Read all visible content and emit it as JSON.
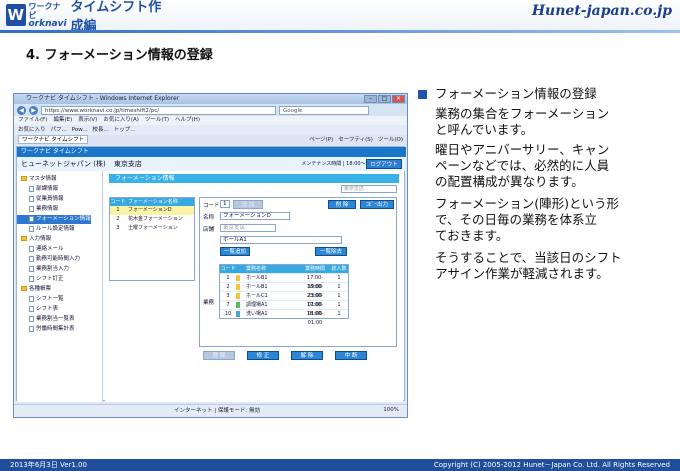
{
  "header": {
    "logo_top": "ワークナビ",
    "logo_bottom": "orknavi",
    "logo_letter": "W",
    "product_title": "タイムシフト作成編",
    "brand": "Hunet-japan.co.jp"
  },
  "slide_title": "4. フォーメーション情報の登録",
  "body_lines": [
    "フォーメーション情報の登録",
    "業務の集合をフォーメーション",
    "と呼んでいます。",
    "曜日やアニバーサリー、キャン",
    "ペーンなどでは、必然的に人員",
    "の配置構成が異なります。",
    "フォーメーション(陣形)という形",
    "で、その日毎の業務を体系立",
    "ておきます。",
    "そうすることで、当該日のシフト",
    "アサイン作業が軽減されます。"
  ],
  "footer": {
    "date": "2013年6月3日 Ver1.00",
    "copyright": "Copyright (C) 2005-2012 Hunet－Japan Co. Ltd. All Rights Reserved"
  },
  "browser": {
    "title": "ワークナビ タイムシフト - Windows Internet Explorer",
    "address": "https://www.worknavi.co.jp/timeshift2/pc/",
    "search": "Google",
    "menus": [
      "ファイル(F)",
      "編集(E)",
      "表示(V)",
      "お気に入り(A)",
      "ツール(T)",
      "ヘルプ(H)"
    ],
    "fav_items": [
      "お気に入り",
      "パフ...",
      "Pow...",
      "校長...",
      "トップ..."
    ],
    "tab_label": "ワークナビ タイムシフト",
    "tools": [
      "ページ(P)",
      "セーフティ(S)",
      "ツール(O)"
    ],
    "status_text": "インターネット | 保護モード: 無効",
    "zoom": "100%"
  },
  "app": {
    "bar_title": "ワークナビ タイムシフト",
    "company": "ヒューネットジャパン (株)",
    "branch": "東京支店",
    "maintenance": "メンテナンス時間 | 18:00～18:30",
    "logout": "ログアウト",
    "sidebar": [
      {
        "label": "マスタ情報",
        "type": "folder",
        "indent": 0
      },
      {
        "label": "部課情報",
        "type": "doc",
        "indent": 1
      },
      {
        "label": "従業員情報",
        "type": "doc",
        "indent": 1
      },
      {
        "label": "業務情報",
        "type": "doc",
        "indent": 1
      },
      {
        "label": "フォーメーション情報",
        "type": "doc",
        "indent": 1,
        "selected": true
      },
      {
        "label": "ルール設定情報",
        "type": "doc",
        "indent": 1
      },
      {
        "label": "入力情報",
        "type": "folder",
        "indent": 0
      },
      {
        "label": "連絡メール",
        "type": "doc",
        "indent": 1
      },
      {
        "label": "勤務可能時間入力",
        "type": "doc",
        "indent": 1
      },
      {
        "label": "業務割当入力",
        "type": "doc",
        "indent": 1
      },
      {
        "label": "シフト訂正",
        "type": "doc",
        "indent": 1
      },
      {
        "label": "各種帳票",
        "type": "folder",
        "indent": 0
      },
      {
        "label": "シフト一覧",
        "type": "doc",
        "indent": 1
      },
      {
        "label": "シフト表",
        "type": "doc",
        "indent": 1
      },
      {
        "label": "業務割当一覧表",
        "type": "doc",
        "indent": 1
      },
      {
        "label": "労働時間集計表",
        "type": "doc",
        "indent": 1
      }
    ],
    "content_title": "フォーメーション情報",
    "branch_select": "東京支店",
    "list_headers": [
      "コード",
      "フォーメーション名称"
    ],
    "list_rows": [
      {
        "code": "1",
        "name": "フォーメーションD",
        "selected": true
      },
      {
        "code": "2",
        "name": "花木金フォーメーション"
      },
      {
        "code": "3",
        "name": "土曜フォーメーション"
      }
    ],
    "detail": {
      "code_label": "コード",
      "code_value": "1",
      "add_btn": "追 加",
      "delete_btn": "削 除",
      "copy_btn": "ｺﾋﾟｰ出力",
      "name_label": "名称",
      "name_value": "フォーメーションD",
      "dept_label": "店舗",
      "dept_value": "東京支店",
      "work_label": "業務",
      "work_select": "ホールA1",
      "bulk_add": "一覧追加",
      "bulk_delete": "一覧除去",
      "grid_headers": [
        "コード",
        "",
        "業務名称",
        "業務時間",
        "総人数"
      ],
      "grid_rows": [
        {
          "code": "1",
          "color": "#f3c53a",
          "name": "ホールB1",
          "time": "17:00-19:00",
          "count": "1"
        },
        {
          "code": "2",
          "color": "#f3c53a",
          "name": "ホールB1",
          "time": "18:00-23:00",
          "count": "1"
        },
        {
          "code": "3",
          "color": "#f3c53a",
          "name": "ホールC1",
          "time": "23:00-01:00",
          "count": "1"
        },
        {
          "code": "7",
          "color": "#5fb85f",
          "name": "調理場A1",
          "time": "17:00-01:00",
          "count": "1"
        },
        {
          "code": "10",
          "color": "#4aa0e0",
          "name": "洗い場A1",
          "time": "18:00-01:00",
          "count": "1"
        }
      ],
      "bottom_buttons": [
        "登 録",
        "修 正",
        "解 除",
        "中 断"
      ]
    }
  }
}
